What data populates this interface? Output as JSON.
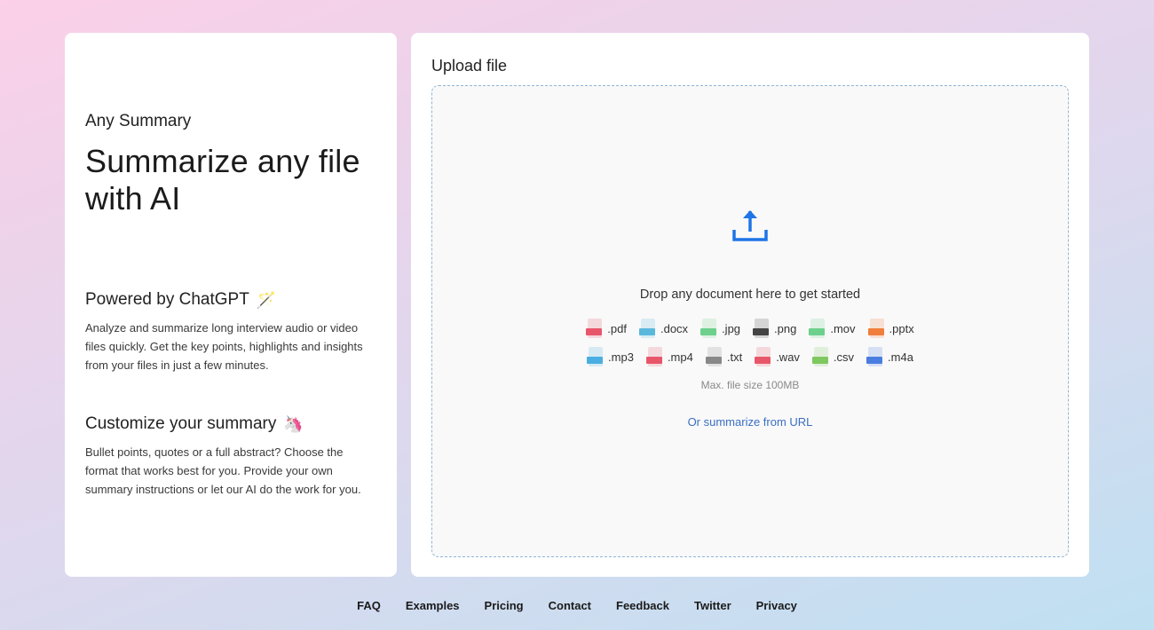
{
  "left_panel": {
    "brand": "Any Summary",
    "headline": "Summarize any file with AI",
    "features": [
      {
        "title": "Powered by ChatGPT",
        "icon": "magic-wand-icon",
        "emoji": "🪄",
        "text": "Analyze and summarize long interview audio or video files quickly. Get the key points, highlights and insights from your files in just a few minutes."
      },
      {
        "title": "Customize your summary",
        "icon": "unicorn-icon",
        "emoji": "🦄",
        "text": "Bullet points, quotes or a full abstract? Choose the format that works best for you. Provide your own summary instructions or let our AI do the work for you."
      }
    ]
  },
  "upload": {
    "title": "Upload file",
    "icon": "upload-icon",
    "drop_text": "Drop any document here to get started",
    "file_types_row1": [
      {
        "ext": ".pdf",
        "color": "#e8566a"
      },
      {
        "ext": ".docx",
        "color": "#5bb8dc"
      },
      {
        "ext": ".jpg",
        "color": "#6dd08c"
      },
      {
        "ext": ".png",
        "color": "#444444"
      },
      {
        "ext": ".mov",
        "color": "#6dd08c"
      },
      {
        "ext": ".pptx",
        "color": "#f07e3c"
      }
    ],
    "file_types_row2": [
      {
        "ext": ".mp3",
        "color": "#4aaee0"
      },
      {
        "ext": ".mp4",
        "color": "#e8566a"
      },
      {
        "ext": ".txt",
        "color": "#888888"
      },
      {
        "ext": ".wav",
        "color": "#e8566a"
      },
      {
        "ext": ".csv",
        "color": "#7fc860"
      },
      {
        "ext": ".m4a",
        "color": "#4a7de0"
      }
    ],
    "max_size": "Max. file size 100MB",
    "url_link": "Or summarize from URL",
    "accent_color": "#1f74e8"
  },
  "footer": {
    "links": [
      "FAQ",
      "Examples",
      "Pricing",
      "Contact",
      "Feedback",
      "Twitter",
      "Privacy"
    ]
  }
}
